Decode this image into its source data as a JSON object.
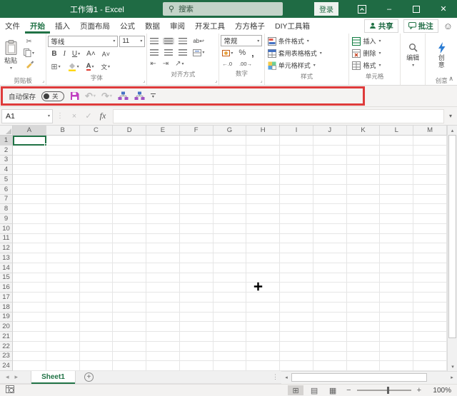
{
  "titlebar": {
    "title": "工作簿1 - Excel",
    "search_placeholder": "搜索",
    "signin": "登录"
  },
  "tabs": {
    "items": [
      "文件",
      "开始",
      "插入",
      "页面布局",
      "公式",
      "数据",
      "审阅",
      "开发工具",
      "方方格子",
      "DIY工具箱"
    ],
    "active_index": 1,
    "share": "共享",
    "comments": "批注"
  },
  "ribbon": {
    "clipboard": {
      "label": "剪贴板",
      "paste": "粘贴"
    },
    "font": {
      "label": "字体",
      "family": "等线",
      "size": "11",
      "bold": "B",
      "italic": "I",
      "underline": "U",
      "phonetic": "文"
    },
    "alignment": {
      "label": "对齐方式",
      "wrap": "ab"
    },
    "number": {
      "label": "数字",
      "format": "常规",
      "percent": "%",
      "comma": ",",
      "inc_decimal": "←.0",
      "dec_decimal": ".00→"
    },
    "styles": {
      "label": "样式",
      "items": [
        "条件格式",
        "套用表格格式",
        "单元格样式"
      ]
    },
    "cells": {
      "label": "单元格",
      "items": [
        "插入",
        "删除",
        "格式"
      ]
    },
    "editing": {
      "label": "编辑"
    },
    "ideas": {
      "label": "创意",
      "button": "创意"
    }
  },
  "qat": {
    "autosave_label": "自动保存",
    "autosave_state": "关"
  },
  "formula_bar": {
    "name_box": "A1",
    "fx": "fx"
  },
  "sheet": {
    "columns": [
      "A",
      "B",
      "C",
      "D",
      "E",
      "F",
      "G",
      "H",
      "I",
      "J",
      "K",
      "L",
      "M"
    ],
    "row_count": 24,
    "selected_column": "A",
    "selected_row": 1,
    "selected_cell": "A1"
  },
  "sheet_tabs": {
    "active": "Sheet1"
  },
  "status_bar": {
    "zoom": "100%"
  },
  "colors": {
    "titlebar_green": "#1F6B44",
    "excel_green": "#217346",
    "highlight_red": "#DE3B3B",
    "save_purple": "#C03EC0",
    "fill_yellow": "#FFD400",
    "font_red": "#E03C31"
  }
}
